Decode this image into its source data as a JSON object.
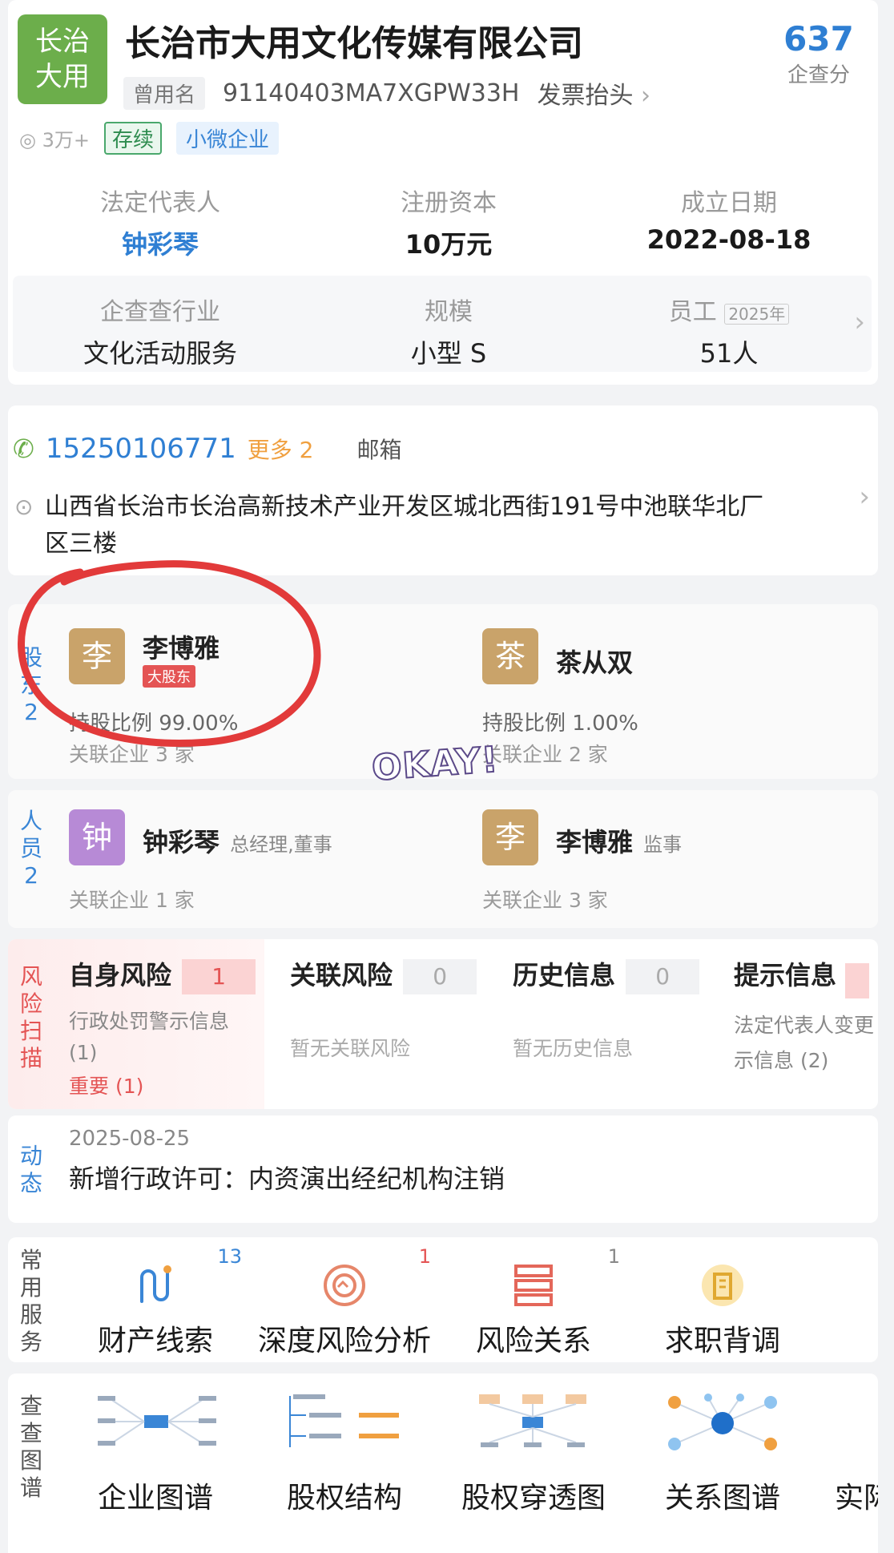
{
  "company": {
    "logo_text_line1": "长治",
    "logo_text_line2": "大用",
    "name": "长治市大用文化传媒有限公司",
    "former_name_tag": "曾用名",
    "credit_code": "91140403MA7XGPW33H",
    "invoice_link": "发票抬头",
    "views": "3万+",
    "status_tag": "存续",
    "size_tag": "小微企业",
    "score_value": "637",
    "score_label": "企查分"
  },
  "overview": {
    "legal_rep_label": "法定代表人",
    "legal_rep_value": "钟彩琴",
    "capital_label": "注册资本",
    "capital_value": "10万元",
    "founded_label": "成立日期",
    "founded_value": "2022-08-18",
    "industry_label": "企查查行业",
    "industry_value": "文化活动服务",
    "scale_label": "规模",
    "scale_value": "小型 S",
    "staff_label": "员工",
    "staff_year": "2025年",
    "staff_value": "51人"
  },
  "contact": {
    "phone": "15250106771",
    "more_label": "更多 2",
    "email_label": "邮箱",
    "address_line1": "山西省长治市长治高新技术产业开发区城北西街191号中池联华北厂",
    "address_line2": "区三楼"
  },
  "shareholders": {
    "side_label": [
      "股",
      "东",
      "2"
    ],
    "items": [
      {
        "avatar_char": "李",
        "avatar_color": "#c9a36a",
        "name": "李博雅",
        "badge": "大股东",
        "ratio": "持股比例 99.00%",
        "related": "关联企业 3 家"
      },
      {
        "avatar_char": "茶",
        "avatar_color": "#c9a36a",
        "name": "茶从双",
        "ratio": "持股比例 1.00%",
        "related": "关联企业 2 家"
      }
    ],
    "sticker_text": "OKAY!"
  },
  "personnel": {
    "side_label": [
      "人",
      "员",
      "2"
    ],
    "items": [
      {
        "avatar_char": "钟",
        "avatar_color": "#b78ad6",
        "name": "钟彩琴",
        "role": "总经理,董事",
        "related": "关联企业 1 家"
      },
      {
        "avatar_char": "李",
        "avatar_color": "#c9a36a",
        "name": "李博雅",
        "role": "监事",
        "related": "关联企业 3 家"
      }
    ]
  },
  "risk": {
    "side_label": [
      "风",
      "险",
      "扫",
      "描"
    ],
    "self": {
      "title": "自身风险",
      "count": "1",
      "line1": "行政处罚警示信息",
      "line2": "(1)",
      "important": "重要 (1)"
    },
    "related": {
      "title": "关联风险",
      "count": "0",
      "desc": "暂无关联风险"
    },
    "history": {
      "title": "历史信息",
      "count": "0",
      "desc": "暂无历史信息"
    },
    "hint": {
      "title": "提示信息",
      "line1": "法定代表人变更",
      "line2": "示信息 (2)"
    }
  },
  "dynamics": {
    "side_label": [
      "动",
      "态"
    ],
    "date": "2025-08-25",
    "text": "新增行政许可：内资演出经纪机构注销"
  },
  "services": {
    "side_label": [
      "常",
      "用",
      "服",
      "务"
    ],
    "items": [
      {
        "label": "财产线索",
        "count": "13",
        "icon": "route-icon"
      },
      {
        "label": "深度风险分析",
        "count": "1",
        "icon": "radar-icon"
      },
      {
        "label": "风险关系",
        "count": "1",
        "icon": "stack-icon"
      },
      {
        "label": "求职背调",
        "count": "",
        "icon": "building-icon"
      }
    ]
  },
  "graphs": {
    "side_label": [
      "查",
      "查",
      "图",
      "谱"
    ],
    "items": [
      {
        "label": "企业图谱"
      },
      {
        "label": "股权结构"
      },
      {
        "label": "股权穿透图"
      },
      {
        "label": "关系图谱"
      },
      {
        "label": "实际"
      }
    ]
  },
  "colors": {
    "accent_blue": "#2f7fd3",
    "logo_green": "#6cae4b",
    "risk_red": "#e45454",
    "orange": "#f0a040"
  }
}
